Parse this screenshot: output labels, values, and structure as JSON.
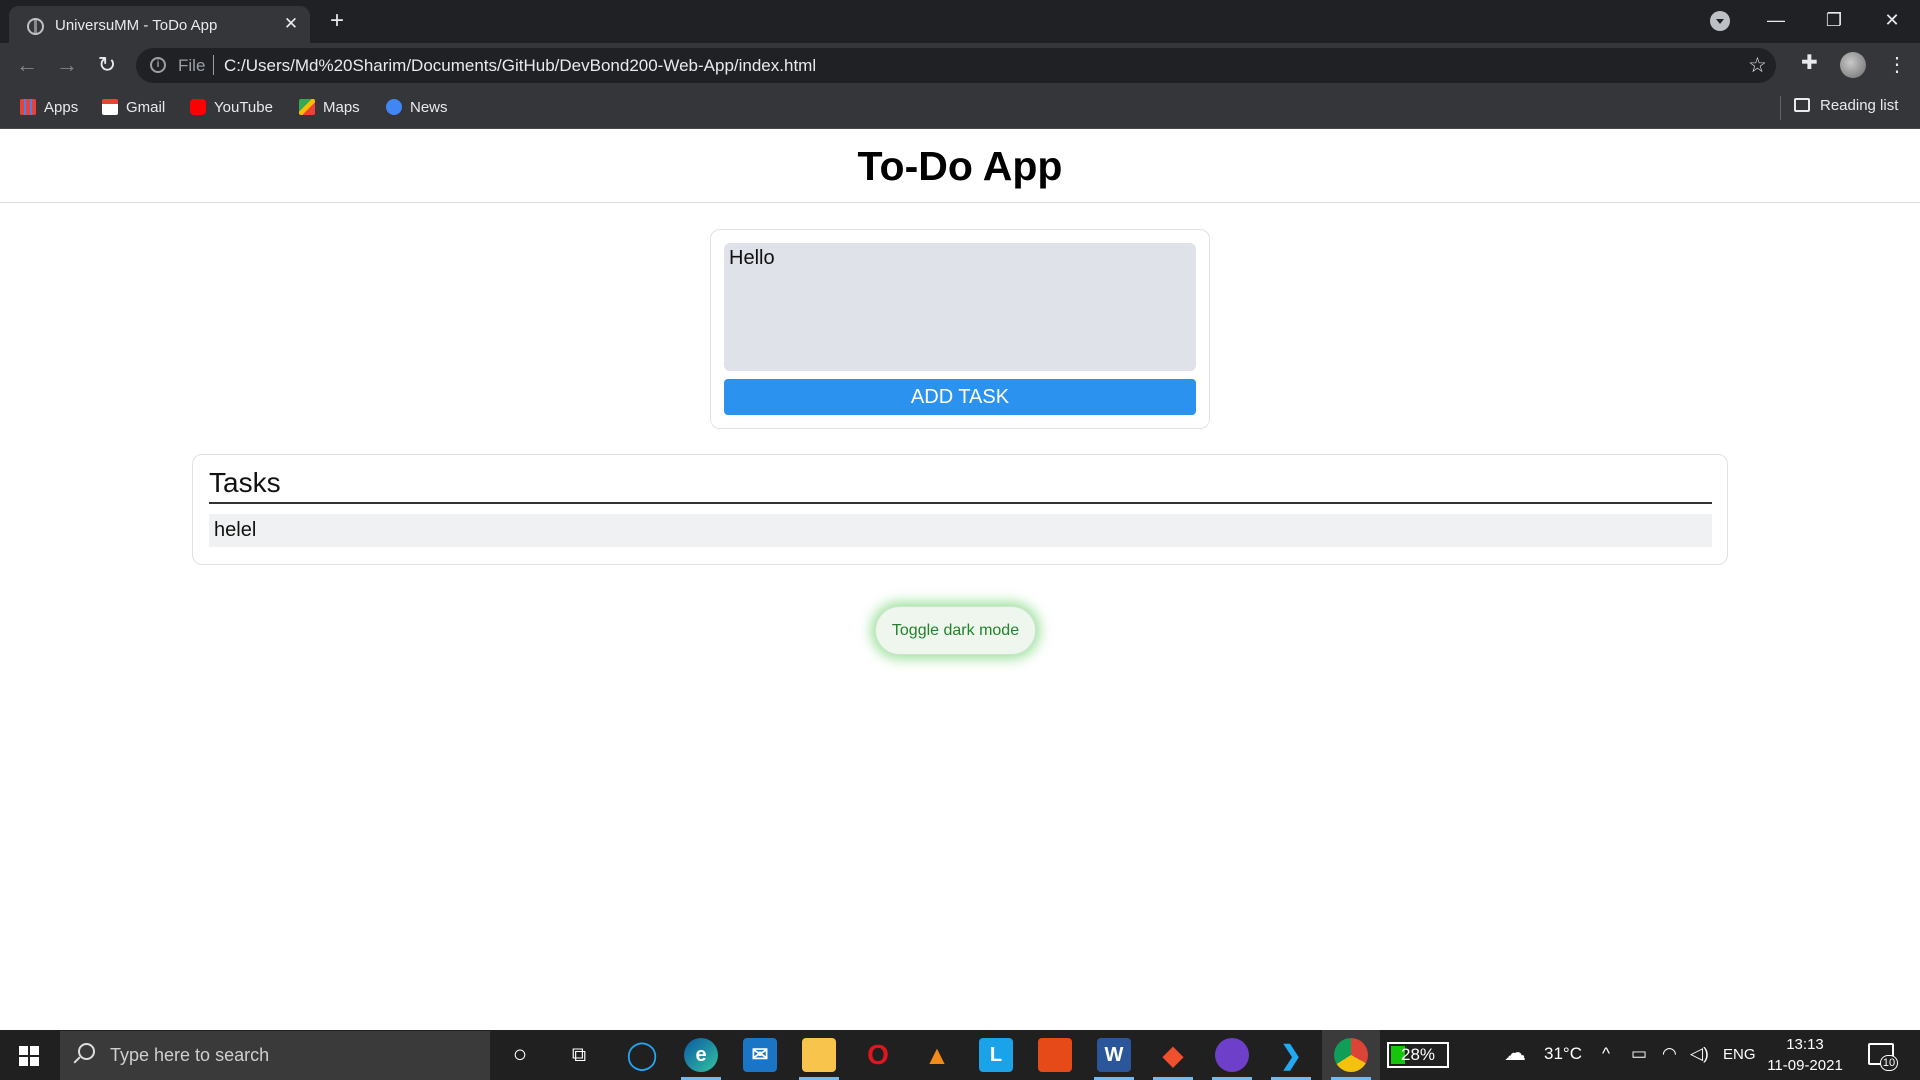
{
  "browser": {
    "tab_title": "UniversuMM - ToDo App",
    "address_scheme": "File",
    "url": "C:/Users/Md%20Sharim/Documents/GitHub/DevBond200-Web-App/index.html",
    "bookmarks": [
      {
        "label": "Apps",
        "icon": "apps-grid-icon"
      },
      {
        "label": "Gmail",
        "icon": "gmail-icon"
      },
      {
        "label": "YouTube",
        "icon": "youtube-icon"
      },
      {
        "label": "Maps",
        "icon": "maps-icon"
      },
      {
        "label": "News",
        "icon": "news-icon"
      }
    ],
    "reading_list": "Reading list"
  },
  "app": {
    "title": "To-Do App",
    "task_input_value": "Hello",
    "add_button": "ADD TASK",
    "tasks_heading": "Tasks",
    "tasks": [
      "helel"
    ],
    "toggle_button": "Toggle dark mode",
    "accent": "#2b93ef",
    "toggle_glow": "#50c850"
  },
  "taskbar": {
    "search_placeholder": "Type here to search",
    "battery": "28%",
    "temperature": "31°C",
    "language": "ENG",
    "time": "13:13",
    "date": "11-09-2021",
    "notifications": "10"
  }
}
